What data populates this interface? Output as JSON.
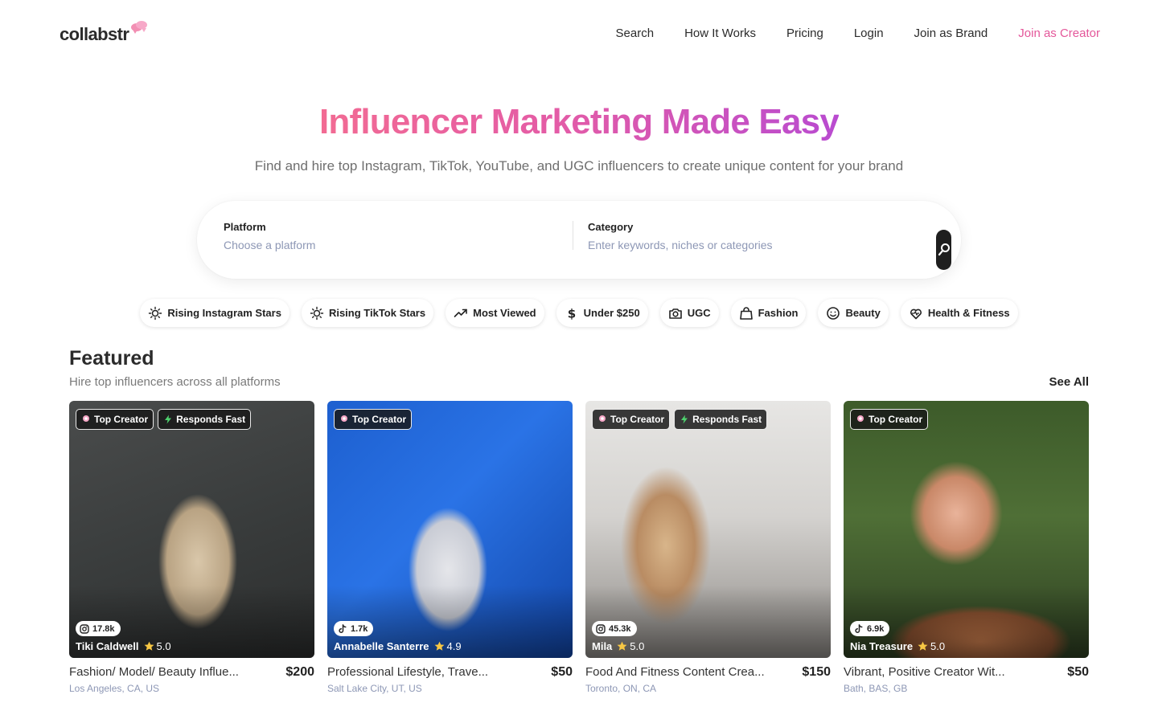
{
  "brand": {
    "name": "collabstr",
    "accent": "#e4579a"
  },
  "nav": {
    "links": [
      "Search",
      "How It Works",
      "Pricing",
      "Login",
      "Join as Brand"
    ],
    "cta": "Join as Creator"
  },
  "hero": {
    "title": "Influencer Marketing Made Easy",
    "subtitle": "Find and hire top Instagram, TikTok, YouTube, and UGC influencers to create unique content for your brand",
    "gradient": [
      "#f26b93",
      "#e45ca6",
      "#b94bd0"
    ]
  },
  "search": {
    "platform": {
      "label": "Platform",
      "placeholder": "Choose a platform"
    },
    "category": {
      "label": "Category",
      "placeholder": "Enter keywords, niches or categories"
    },
    "button_icon": "search-icon"
  },
  "chips": [
    {
      "label": "Rising Instagram Stars",
      "icon": "sparkle-icon"
    },
    {
      "label": "Rising TikTok Stars",
      "icon": "sparkle-icon"
    },
    {
      "label": "Most Viewed",
      "icon": "trending-up-icon"
    },
    {
      "label": "Under $250",
      "icon": "dollar-icon"
    },
    {
      "label": "UGC",
      "icon": "camera-icon"
    },
    {
      "label": "Fashion",
      "icon": "shopping-bag-icon"
    },
    {
      "label": "Beauty",
      "icon": "smile-icon"
    },
    {
      "label": "Health & Fitness",
      "icon": "heart-pulse-icon"
    }
  ],
  "featured": {
    "title": "Featured",
    "subtitle": "Hire top influencers across all platforms",
    "see_all": "See All",
    "cards": [
      {
        "badges": [
          "Top Creator",
          "Responds Fast"
        ],
        "platform": "instagram",
        "followers": "17.8k",
        "name": "Tiki Caldwell",
        "rating": "5.0",
        "description": "Fashion/ Model/ Beauty Influe...",
        "price": "$200",
        "location": "Los Angeles, CA, US"
      },
      {
        "badges": [
          "Top Creator"
        ],
        "platform": "tiktok",
        "followers": "1.7k",
        "name": "Annabelle Santerre",
        "rating": "4.9",
        "description": "Professional Lifestyle, Trave...",
        "price": "$50",
        "location": "Salt Lake City, UT, US"
      },
      {
        "badges": [
          "Top Creator",
          "Responds Fast"
        ],
        "platform": "instagram",
        "followers": "45.3k",
        "name": "Mila",
        "rating": "5.0",
        "description": "Food And Fitness Content Crea...",
        "price": "$150",
        "location": "Toronto, ON, CA"
      },
      {
        "badges": [
          "Top Creator"
        ],
        "platform": "tiktok",
        "followers": "6.9k",
        "name": "Nia Treasure",
        "rating": "5.0",
        "description": "Vibrant, Positive Creator Wit...",
        "price": "$50",
        "location": "Bath, BAS, GB"
      }
    ]
  }
}
